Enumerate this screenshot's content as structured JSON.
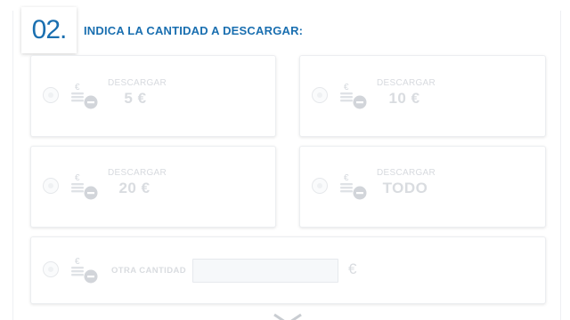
{
  "step": {
    "number": "02.",
    "title": "INDICA LA CANTIDAD A DESCARGAR:"
  },
  "options": [
    {
      "small": "DESCARGAR",
      "big": "5 €"
    },
    {
      "small": "DESCARGAR",
      "big": "10 €"
    },
    {
      "small": "DESCARGAR",
      "big": "20 €"
    },
    {
      "small": "DESCARGAR",
      "big": "TODO"
    }
  ],
  "other": {
    "label": "OTRA CANTIDAD",
    "value": "",
    "suffix": "€"
  },
  "icons": {
    "option_icon": "coins-minus-icon",
    "expand_icon": "chevron-down-icon"
  },
  "colors": {
    "accent": "#1a6fb0",
    "disabled_text": "#d9dce0"
  }
}
